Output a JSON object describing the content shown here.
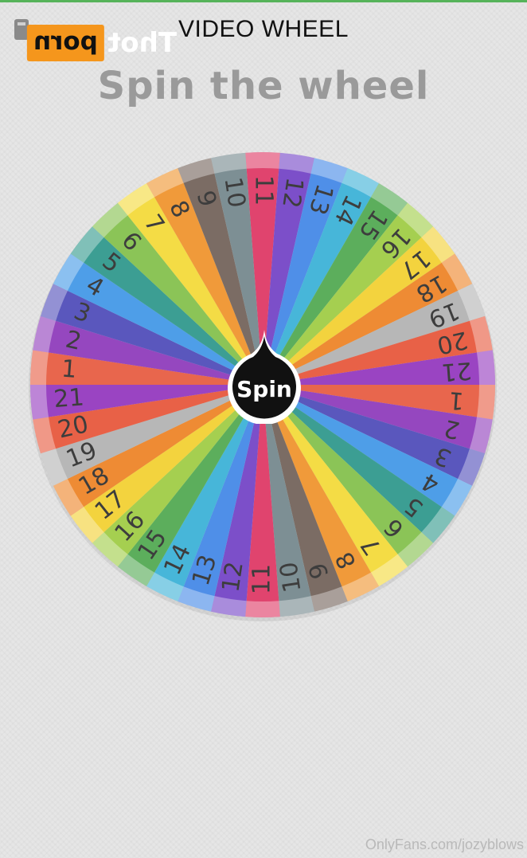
{
  "header": {
    "title": "VIDEO WHEEL",
    "watermark_box_text": "porn",
    "watermark_text": "Thot"
  },
  "subtitle": "Spin the wheel",
  "wheel": {
    "segments": [
      {
        "label": "11",
        "color": "#e0446e"
      },
      {
        "label": "12",
        "color": "#7c4fc9"
      },
      {
        "label": "13",
        "color": "#4f8fe8"
      },
      {
        "label": "14",
        "color": "#47b6d9"
      },
      {
        "label": "15",
        "color": "#5cae5c"
      },
      {
        "label": "16",
        "color": "#a5cf50"
      },
      {
        "label": "17",
        "color": "#f3d33e"
      },
      {
        "label": "18",
        "color": "#ee8b34"
      },
      {
        "label": "19",
        "color": "#b7b7b7"
      },
      {
        "label": "20",
        "color": "#e86147"
      },
      {
        "label": "21",
        "color": "#9a44c2"
      },
      {
        "label": "1",
        "color": "#e8664d"
      },
      {
        "label": "2",
        "color": "#9547bf"
      },
      {
        "label": "3",
        "color": "#5a57bd"
      },
      {
        "label": "4",
        "color": "#4e9ee8"
      },
      {
        "label": "5",
        "color": "#3c9e93"
      },
      {
        "label": "6",
        "color": "#8bc457"
      },
      {
        "label": "7",
        "color": "#f4dc45"
      },
      {
        "label": "8",
        "color": "#f09a3a"
      },
      {
        "label": "9",
        "color": "#7b6c64"
      },
      {
        "label": "10",
        "color": "#7d8f94"
      },
      {
        "label": "11",
        "color": "#e0446e"
      },
      {
        "label": "12",
        "color": "#7c4fc9"
      },
      {
        "label": "13",
        "color": "#4f8fe8"
      },
      {
        "label": "14",
        "color": "#47b6d9"
      },
      {
        "label": "15",
        "color": "#5cae5c"
      },
      {
        "label": "16",
        "color": "#a5cf50"
      },
      {
        "label": "17",
        "color": "#f3d33e"
      },
      {
        "label": "18",
        "color": "#ee8b34"
      },
      {
        "label": "19",
        "color": "#b7b7b7"
      },
      {
        "label": "20",
        "color": "#e86147"
      },
      {
        "label": "21",
        "color": "#9a44c2"
      },
      {
        "label": "1",
        "color": "#e8664d"
      },
      {
        "label": "2",
        "color": "#9547bf"
      },
      {
        "label": "3",
        "color": "#5a57bd"
      },
      {
        "label": "4",
        "color": "#4e9ee8"
      },
      {
        "label": "5",
        "color": "#3c9e93"
      },
      {
        "label": "6",
        "color": "#8bc457"
      },
      {
        "label": "7",
        "color": "#f4dc45"
      },
      {
        "label": "8",
        "color": "#f09a3a"
      },
      {
        "label": "9",
        "color": "#7b6c64"
      },
      {
        "label": "10",
        "color": "#7d8f94"
      }
    ],
    "spin_label": "Spin"
  },
  "footer": {
    "watermark": "OnlyFans.com/jozyblows"
  }
}
